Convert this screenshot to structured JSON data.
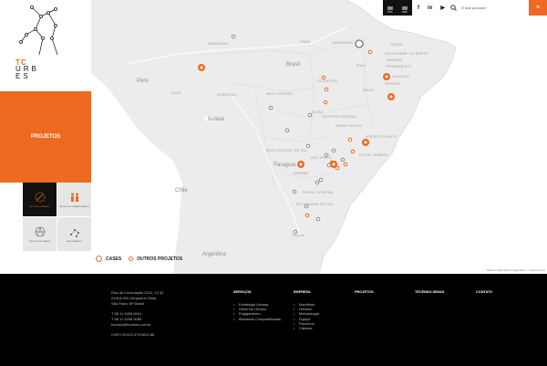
{
  "brand": {
    "tc": "TC",
    "urbes": "URB ES"
  },
  "sidebar": {
    "active_section": "PROJETOS",
    "tiles": [
      {
        "label": "ESTUDOS URBANOS",
        "icon": "explosion-icon",
        "active": true
      },
      {
        "label": "PROJETOS COMPARTILHADOS",
        "icon": "people-icon",
        "active": false
      },
      {
        "label": "PROJETOS E PLANOS",
        "icon": "network-icon",
        "active": false
      },
      {
        "label": "REGULAMENTO",
        "icon": "nodes-icon",
        "active": false
      }
    ]
  },
  "topbar": {
    "languages": [
      "PTG",
      "ENG"
    ],
    "social": [
      "f",
      "in",
      "▶"
    ],
    "search_placeholder": "O que procura?",
    "menu_icon": "≡"
  },
  "map": {
    "countries": [
      {
        "label": "Brasil"
      },
      {
        "label": "Peru"
      },
      {
        "label": "Bolivia"
      },
      {
        "label": "Paraguai"
      },
      {
        "label": "Chile"
      },
      {
        "label": "Argentina"
      },
      {
        "label": "Uruguai"
      }
    ],
    "states": [
      "AMAZONAS",
      "PARÁ",
      "MARANHÃO",
      "CEARÁ",
      "RIO GRANDE DO NORTE",
      "PARAÍBA",
      "PERNAMBUCO",
      "ALAGOAS",
      "SERGIPE",
      "BAHIA",
      "TOCANTINS",
      "PIAUÍ",
      "GOIÁS",
      "MATO GROSSO",
      "RONDÔNIA",
      "ACRE",
      "MINAS GERAIS",
      "ESPÍRITO SANTO",
      "RIO DE JANEIRO",
      "SÃO PAULO",
      "MATO GROSSO DO SUL",
      "PARANÁ",
      "SANTA CATARINA",
      "RIO GRANDE DO SUL",
      "DISTRITO FEDERAL"
    ],
    "attribution": "Dados do mapa ©2017 Google    500 km ⎯⎯    Termos de Uso",
    "colors": {
      "land": "#ececec",
      "water": "#ffffff",
      "accent": "#ee6a22",
      "gray_marker": "#888888"
    }
  },
  "legend": {
    "cases": "CASES",
    "outros": "OUTROS PROJETOS"
  },
  "footer": {
    "address": [
      "Rua da Consolação 2214, 13 32",
      "01416-000 Cerqueira César",
      "São Paulo SP Brasil",
      "",
      "T 55 11 3463 8161",
      "T 55 11 3256 0089",
      "tcurbes@tcurbes.com.br",
      "",
      "CNPJ 09.024.371/0001-88"
    ],
    "columns": [
      {
        "heading": "SERVIÇOS",
        "items": [
          "Estratégia Urbana",
          "Desenho Urbano",
          "Engajamento",
          "Bicicletas Compartilhadas"
        ]
      },
      {
        "heading": "EMPRESA",
        "items": [
          "Manifesto",
          "História",
          "Metodologia",
          "Equipe",
          "Parceiros",
          "Clientes"
        ]
      },
      {
        "heading": "PROJETOS",
        "items": []
      },
      {
        "heading": "TECENDO IDEIAS",
        "items": []
      },
      {
        "heading": "CONTATO",
        "items": []
      }
    ]
  }
}
